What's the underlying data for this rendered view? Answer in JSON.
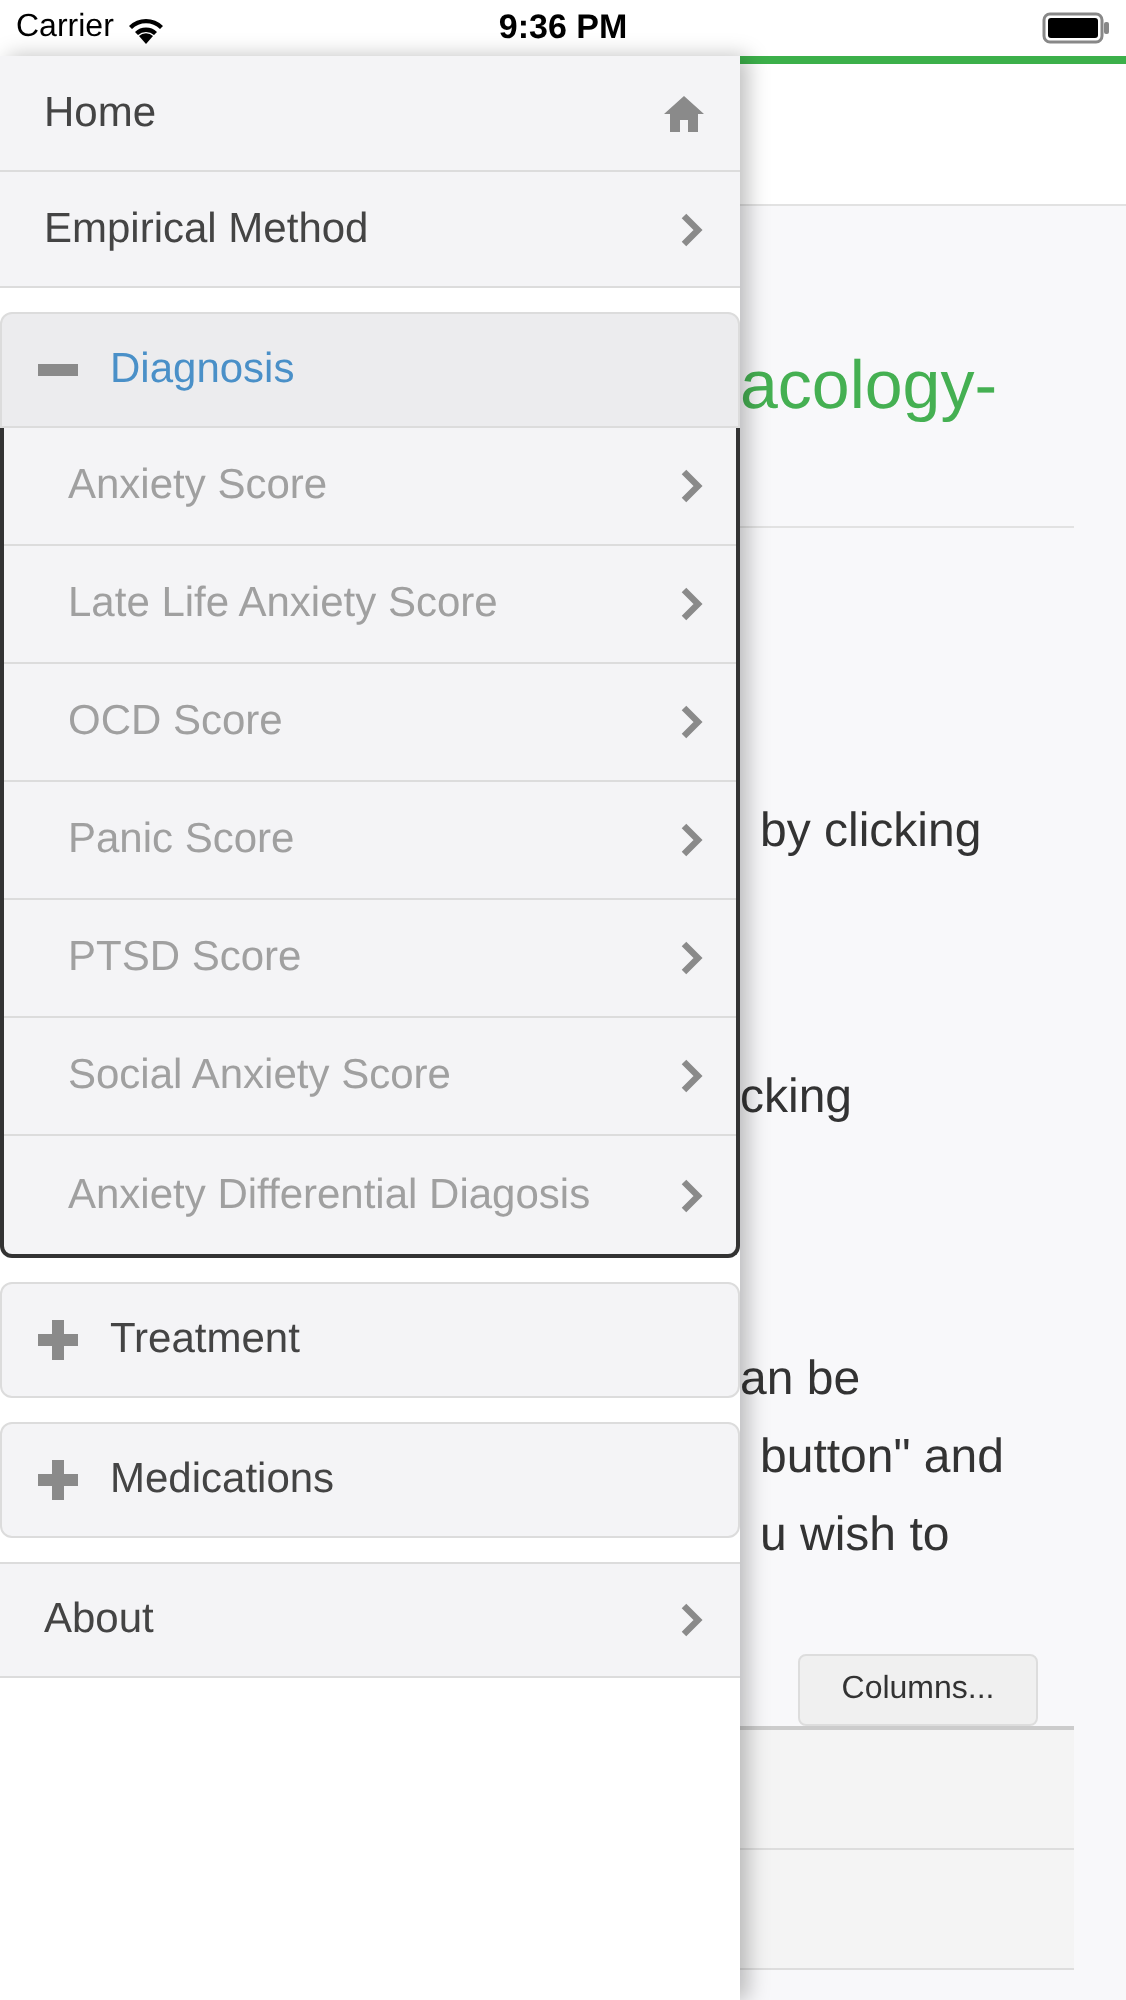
{
  "status_bar": {
    "carrier": "Carrier",
    "time": "9:36 PM"
  },
  "menu": [
    {
      "kind": "home",
      "label": "Home"
    },
    {
      "kind": "link",
      "label": "Empirical Method"
    },
    {
      "kind": "group",
      "label": "Diagnosis",
      "expanded": true,
      "children": [
        {
          "label": "Anxiety Score"
        },
        {
          "label": "Late Life Anxiety Score"
        },
        {
          "label": "OCD Score"
        },
        {
          "label": "Panic Score"
        },
        {
          "label": "PTSD Score"
        },
        {
          "label": "Social Anxiety Score"
        },
        {
          "label": "Anxiety Differential Diagosis"
        }
      ]
    },
    {
      "kind": "group",
      "label": "Treatment",
      "expanded": false
    },
    {
      "kind": "group",
      "label": "Medications",
      "expanded": false
    },
    {
      "kind": "link",
      "label": "About"
    }
  ],
  "content": {
    "heading": "acology-",
    "paragraph_1": "by clicking",
    "paragraph_2": "cking",
    "paragraph_3": [
      "an be",
      "button\" and",
      "u wish to"
    ],
    "columns_button": "Columns..."
  }
}
